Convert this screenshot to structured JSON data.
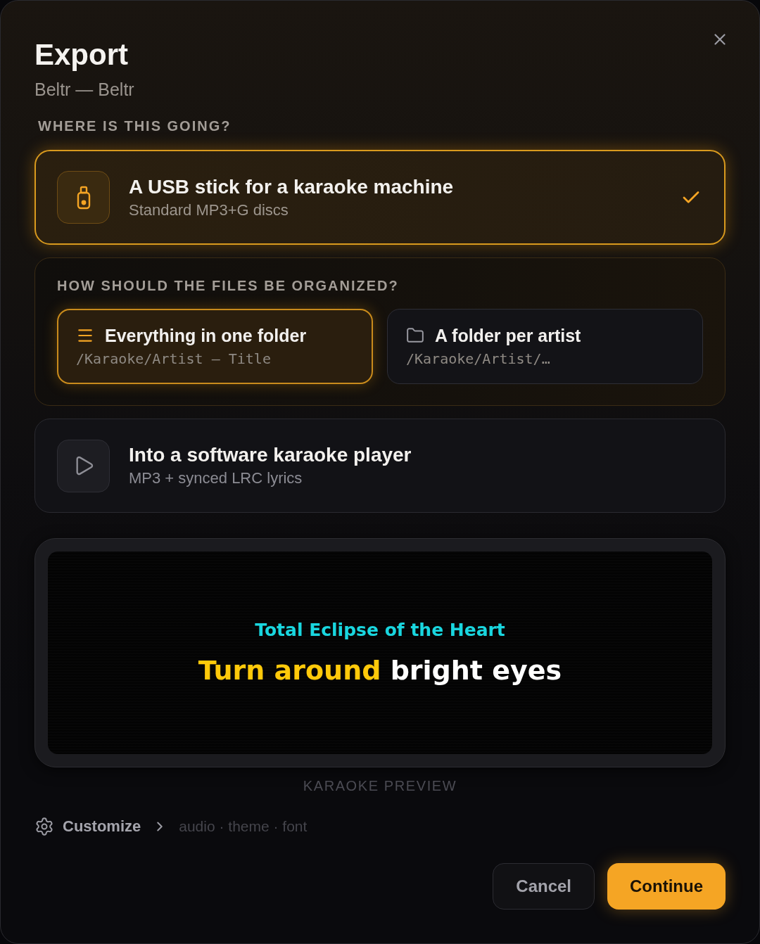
{
  "dialog": {
    "title": "Export",
    "subtitle": "Beltr — Beltr"
  },
  "destination": {
    "heading": "WHERE IS THIS GOING?",
    "options": [
      {
        "kind": "usb",
        "title": "A USB stick for a karaoke machine",
        "subtitle": "Standard MP3+G discs",
        "selected": true,
        "organize": {
          "heading": "HOW SHOULD THE FILES BE ORGANIZED?",
          "options": [
            {
              "kind": "single_folder",
              "title": "Everything in one folder",
              "path": "/Karaoke/Artist – Title",
              "selected": true
            },
            {
              "kind": "per_artist",
              "title": "A folder per artist",
              "path": "/Karaoke/Artist/…",
              "selected": false
            }
          ]
        }
      },
      {
        "kind": "software",
        "title": "Into a software karaoke player",
        "subtitle": "MP3 + synced LRC lyrics",
        "selected": false
      }
    ]
  },
  "preview": {
    "song_title": "Total Eclipse of the Heart",
    "lyric": {
      "sung": "Turn around",
      "unsung": "bright eyes"
    },
    "caption": "KARAOKE PREVIEW"
  },
  "customize": {
    "label": "Customize",
    "hint": "audio · theme · font"
  },
  "buttons": [
    {
      "kind": "secondary",
      "label": "Cancel"
    },
    {
      "kind": "primary",
      "label": "Continue"
    }
  ]
}
